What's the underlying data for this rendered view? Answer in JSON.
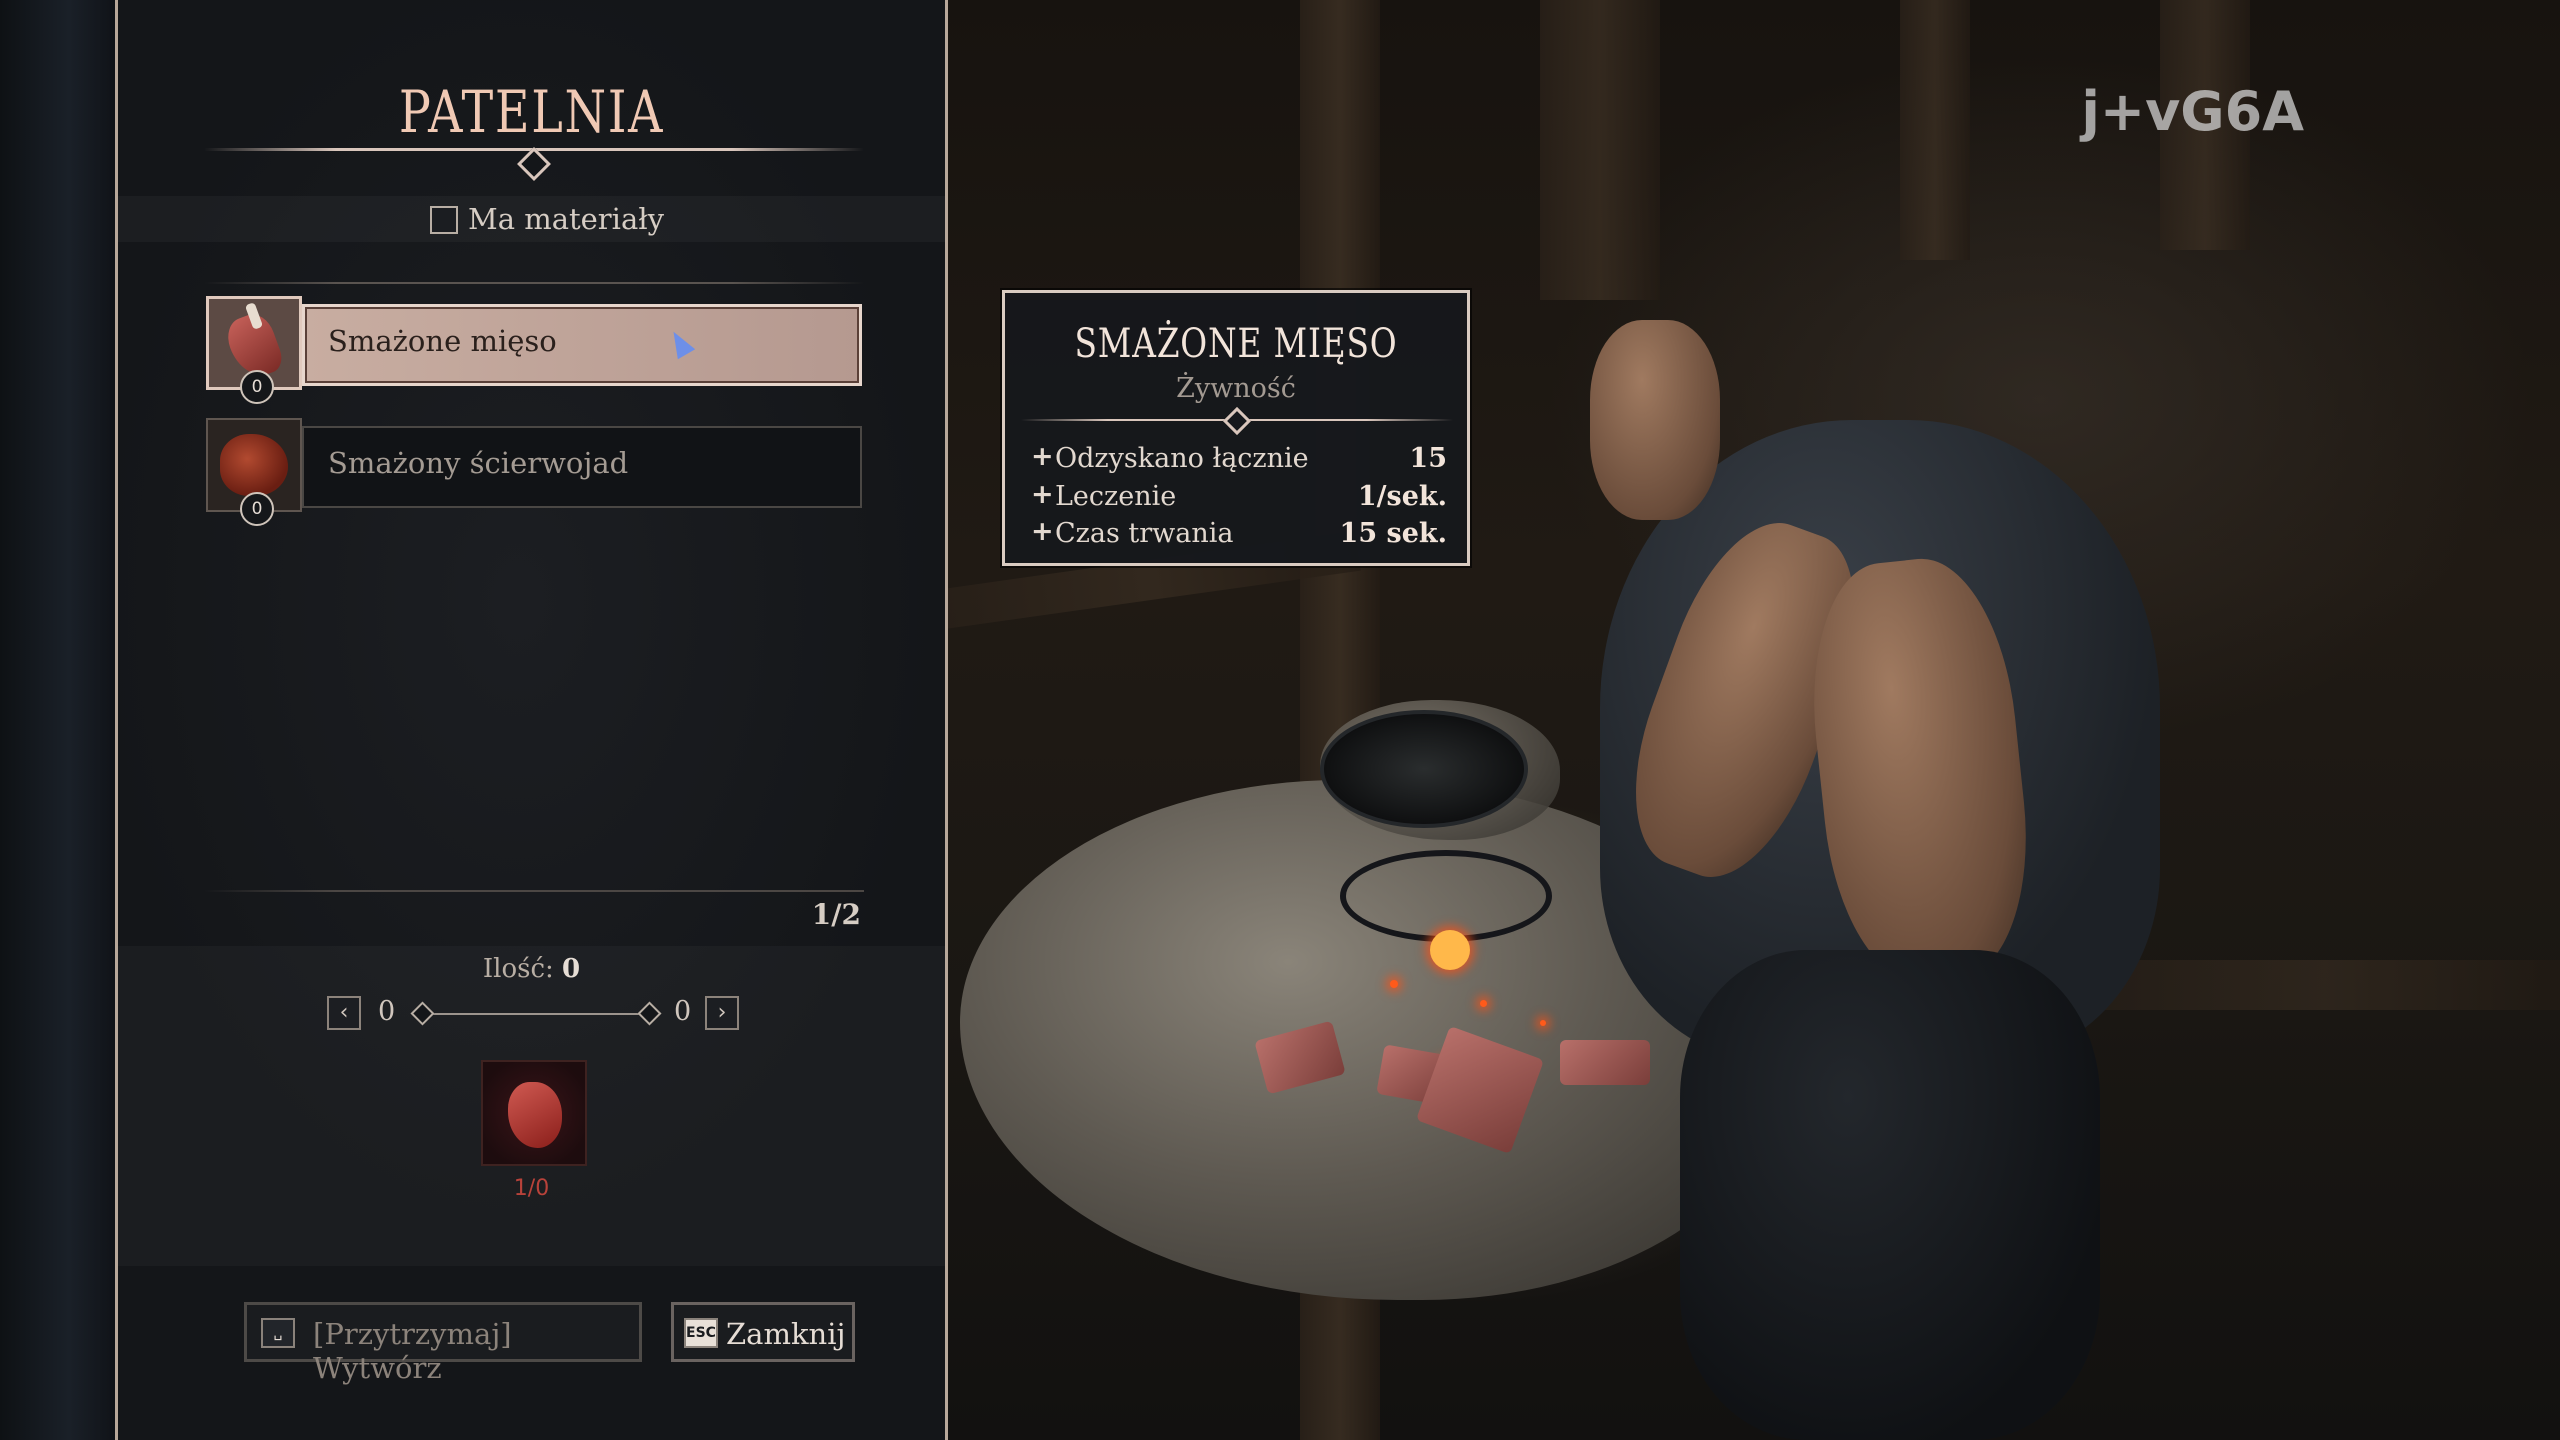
{
  "watermark": "j+vG6A",
  "panel": {
    "title": "PATELNIA",
    "filter": {
      "label": "Ma materiały",
      "checked": false
    },
    "recipes": [
      {
        "name": "Smażone mięso",
        "count": "0",
        "selected": true,
        "icon": "cooked-meat-icon"
      },
      {
        "name": "Smażony ścierwojad",
        "count": "0",
        "selected": false,
        "icon": "cooked-scavenger-icon"
      }
    ],
    "page": "1/2",
    "quantity": {
      "label": "Ilość:",
      "value": "0",
      "min": "0",
      "max": "0",
      "prev_icon": "chevron-left-icon",
      "next_icon": "chevron-right-icon"
    },
    "ingredient": {
      "icon": "raw-meat-icon",
      "count": "1/0"
    },
    "buttons": {
      "craft": {
        "key": "␣",
        "label": "[Przytrzymaj] Wytwórz"
      },
      "close": {
        "key": "ESC",
        "label": "Zamknij"
      }
    }
  },
  "tooltip": {
    "title": "SMAŻONE MIĘSO",
    "subtitle": "Żywność",
    "stats": [
      {
        "label": "Odzyskano łącznie",
        "value": "15"
      },
      {
        "label": "Leczenie",
        "value": "1/sek."
      },
      {
        "label": "Czas trwania",
        "value": "15 sek."
      }
    ]
  },
  "colors": {
    "accent": "#f0c9b4",
    "selected_row": "#c8ada1",
    "ingredient_missing": "#b8423a",
    "cursor": "#6d8fe8"
  }
}
